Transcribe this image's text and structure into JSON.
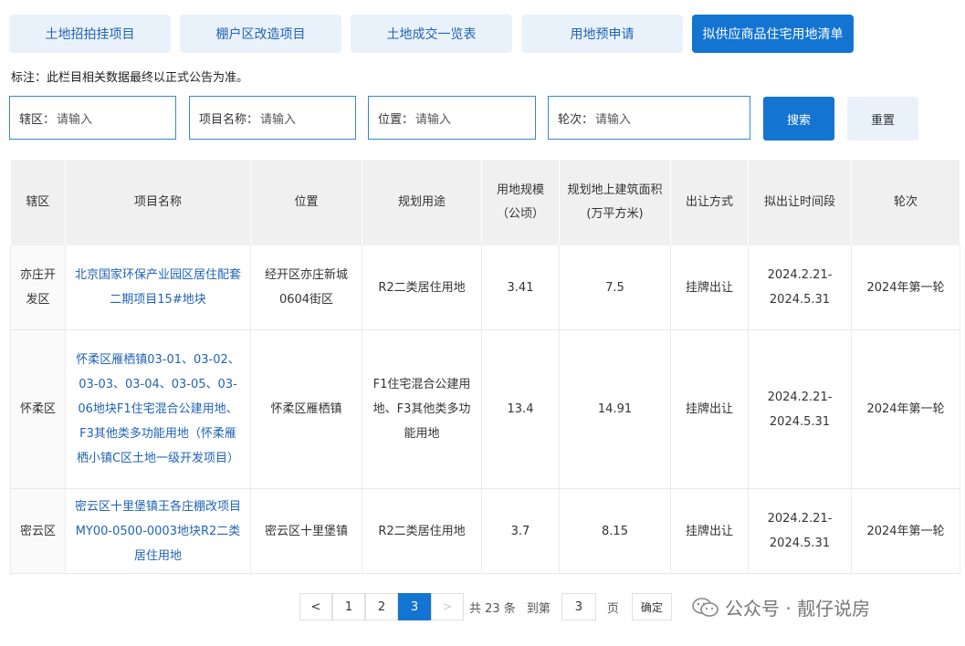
{
  "tabs": [
    {
      "label": "土地招拍挂项目",
      "active": false
    },
    {
      "label": "棚户区改造项目",
      "active": false
    },
    {
      "label": "土地成交一览表",
      "active": false
    },
    {
      "label": "用地预申请",
      "active": false
    },
    {
      "label": "拟供应商品住宅用地清单",
      "active": true
    }
  ],
  "note": "标注：此栏目相关数据最终以正式公告为准。",
  "filters": [
    {
      "label": "辖区：",
      "placeholder": "请输入"
    },
    {
      "label": "项目名称：",
      "placeholder": "请输入"
    },
    {
      "label": "位置：",
      "placeholder": "请输入"
    },
    {
      "label": "轮次：",
      "placeholder": "请输入"
    }
  ],
  "buttons": {
    "search": "搜索",
    "reset": "重置"
  },
  "table": {
    "headers": [
      "辖区",
      "项目名称",
      "位置",
      "规划用途",
      "用地规模（公顷）",
      "规划地上建筑面积(万平方米)",
      "出让方式",
      "拟出让时间段",
      "轮次"
    ],
    "rows": [
      {
        "district": "亦庄开发区",
        "project": "北京国家环保产业园区居住配套二期项目15#地块",
        "location": "经开区亦庄新城0604街区",
        "use": "R2二类居住用地",
        "area": "3.41",
        "floor_area": "7.5",
        "method": "挂牌出让",
        "period": "2024.2.21-2024.5.31",
        "round": "2024年第一轮"
      },
      {
        "district": "怀柔区",
        "project": "怀柔区雁栖镇03-01、03-02、03-03、03-04、03-05、03-06地块F1住宅混合公建用地、F3其他类多功能用地（怀柔雁栖小镇C区土地一级开发项目）",
        "location": "怀柔区雁栖镇",
        "use": "F1住宅混合公建用地、F3其他类多功能用地",
        "area": "13.4",
        "floor_area": "14.91",
        "method": "挂牌出让",
        "period": "2024.2.21-2024.5.31",
        "round": "2024年第一轮"
      },
      {
        "district": "密云区",
        "project": "密云区十里堡镇王各庄棚改项目MY00-0500-0003地块R2二类居住用地",
        "location": "密云区十里堡镇",
        "use": "R2二类居住用地",
        "area": "3.7",
        "floor_area": "8.15",
        "method": "挂牌出让",
        "period": "2024.2.21-2024.5.31",
        "round": "2024年第一轮"
      }
    ]
  },
  "pagination": {
    "prev": "<",
    "pages": [
      "1",
      "2",
      "3"
    ],
    "current": "3",
    "next": ">",
    "total": "共 23 条",
    "goto": "到第",
    "goto_value": "3",
    "page_unit": "页",
    "confirm": "确定"
  },
  "watermark": "公众号 · 靓仔说房",
  "colors": {
    "accent": "#1474d1",
    "tab_bg": "#e9f2fb",
    "link": "#1f63b6"
  }
}
